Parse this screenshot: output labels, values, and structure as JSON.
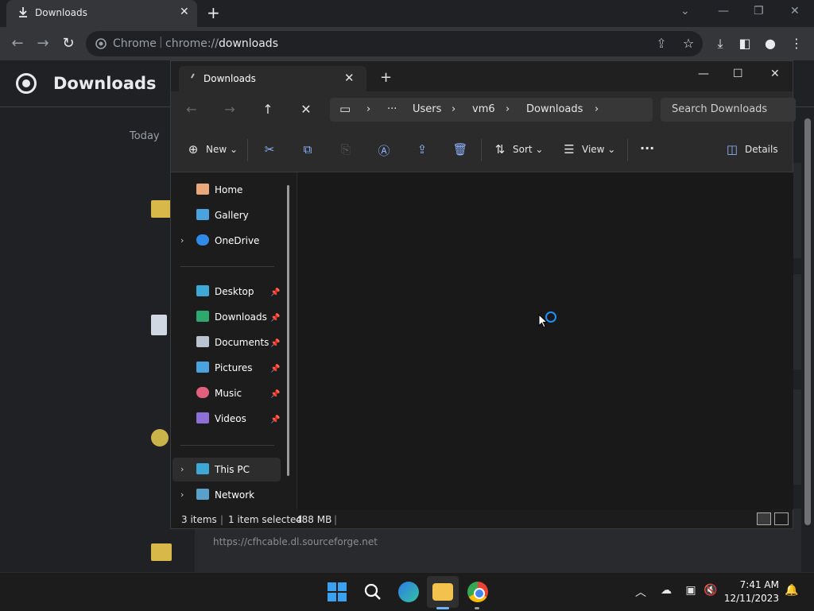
{
  "chrome": {
    "tab_title": "Downloads",
    "omnibox_site": "Chrome",
    "omnibox_url_prefix": "chrome://",
    "omnibox_url_path": "downloads"
  },
  "downloads_page": {
    "title": "Downloads",
    "section_today": "Today",
    "item_url": "https://cfhcable.dl.sourceforge.net"
  },
  "explorer": {
    "tab_title": "Downloads",
    "breadcrumb": [
      "Users",
      "vm6",
      "Downloads"
    ],
    "search_placeholder": "Search Downloads",
    "commands": {
      "new": "New",
      "sort": "Sort",
      "view": "View",
      "details": "Details"
    },
    "nav": {
      "home": "Home",
      "gallery": "Gallery",
      "onedrive": "OneDrive",
      "desktop": "Desktop",
      "downloads": "Downloads",
      "documents": "Documents",
      "pictures": "Pictures",
      "music": "Music",
      "videos": "Videos",
      "this_pc": "This PC",
      "network": "Network"
    },
    "status": {
      "items": "3 items",
      "selected": "1 item selected",
      "size": "488 MB"
    }
  },
  "taskbar": {
    "time": "7:41 AM",
    "date": "12/11/2023"
  },
  "colors": {
    "accent": "#1e90ff",
    "chrome_bg": "#202124",
    "explorer_bg": "#1c1c1c"
  }
}
